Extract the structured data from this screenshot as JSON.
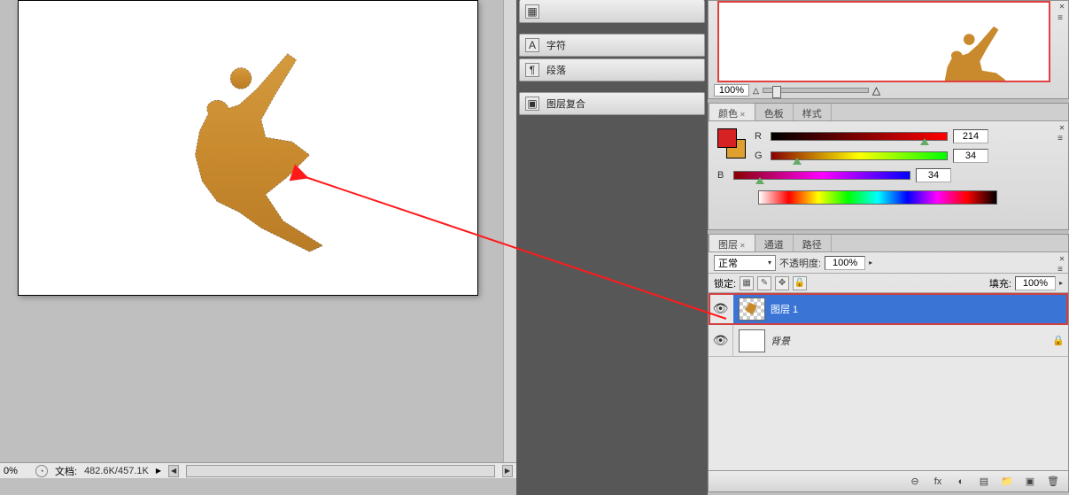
{
  "statusbar": {
    "zoom": "0%",
    "doc_label": "文档:",
    "doc_stats": "482.6K/457.1K"
  },
  "midpanel": {
    "items": [
      {
        "icon": "▦",
        "label": ""
      },
      {
        "icon": "A",
        "label": "字符"
      },
      {
        "icon": "¶",
        "label": "段落"
      },
      {
        "icon": "▣",
        "label": "图层复合"
      }
    ]
  },
  "navigator": {
    "zoom": "100%"
  },
  "color": {
    "tabs": [
      "颜色",
      "色板",
      "样式"
    ],
    "active_tab": 0,
    "channels": {
      "R": 214,
      "G": 34,
      "B": 34
    }
  },
  "layers": {
    "tabs": [
      "图层",
      "通道",
      "路径"
    ],
    "active_tab": 0,
    "blend_mode": "正常",
    "opacity_label": "不透明度:",
    "opacity": "100%",
    "lock_label": "锁定:",
    "fill_label": "填充:",
    "fill": "100%",
    "rows": [
      {
        "name": "图层 1",
        "active": true,
        "locked": false
      },
      {
        "name": "背景",
        "active": false,
        "locked": true
      }
    ],
    "footer_icons": [
      "⊖",
      "fx",
      "◐",
      "▤",
      "📁",
      "▣",
      "🗑"
    ]
  }
}
